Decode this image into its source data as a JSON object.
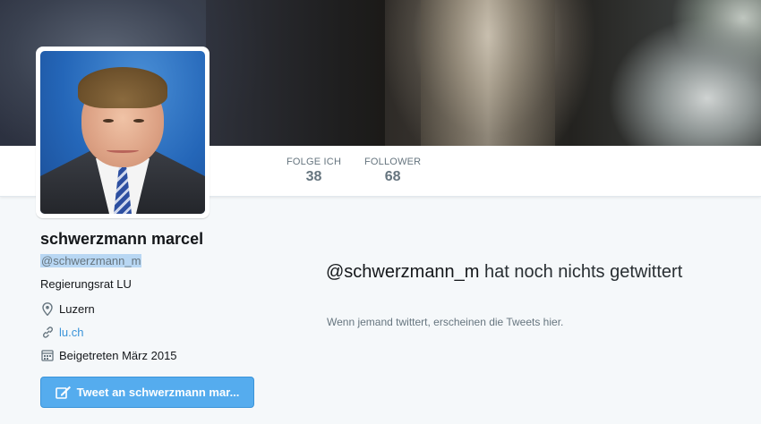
{
  "profile": {
    "name": "schwerzmann marcel",
    "handle": "@schwerzmann_m",
    "bio": "Regierungsrat LU",
    "location": "Luzern",
    "website": "lu.ch",
    "joined": "Beigetreten März 2015"
  },
  "nav": {
    "stats": [
      {
        "label": "FOLGE ICH",
        "value": "38"
      },
      {
        "label": "FOLLOWER",
        "value": "68"
      }
    ]
  },
  "actions": {
    "tweet_to_label": "Tweet an schwerzmann mar..."
  },
  "timeline": {
    "empty_handle": "@schwerzmann_m",
    "empty_title_rest": " hat noch nichts getwittert",
    "empty_subtitle": "Wenn jemand twittert, erscheinen die Tweets hier."
  },
  "colors": {
    "accent": "#55acee",
    "link": "#3b94d9",
    "background": "#f5f8fa"
  },
  "icons": [
    "location-pin-icon",
    "link-icon",
    "calendar-icon",
    "compose-icon"
  ]
}
